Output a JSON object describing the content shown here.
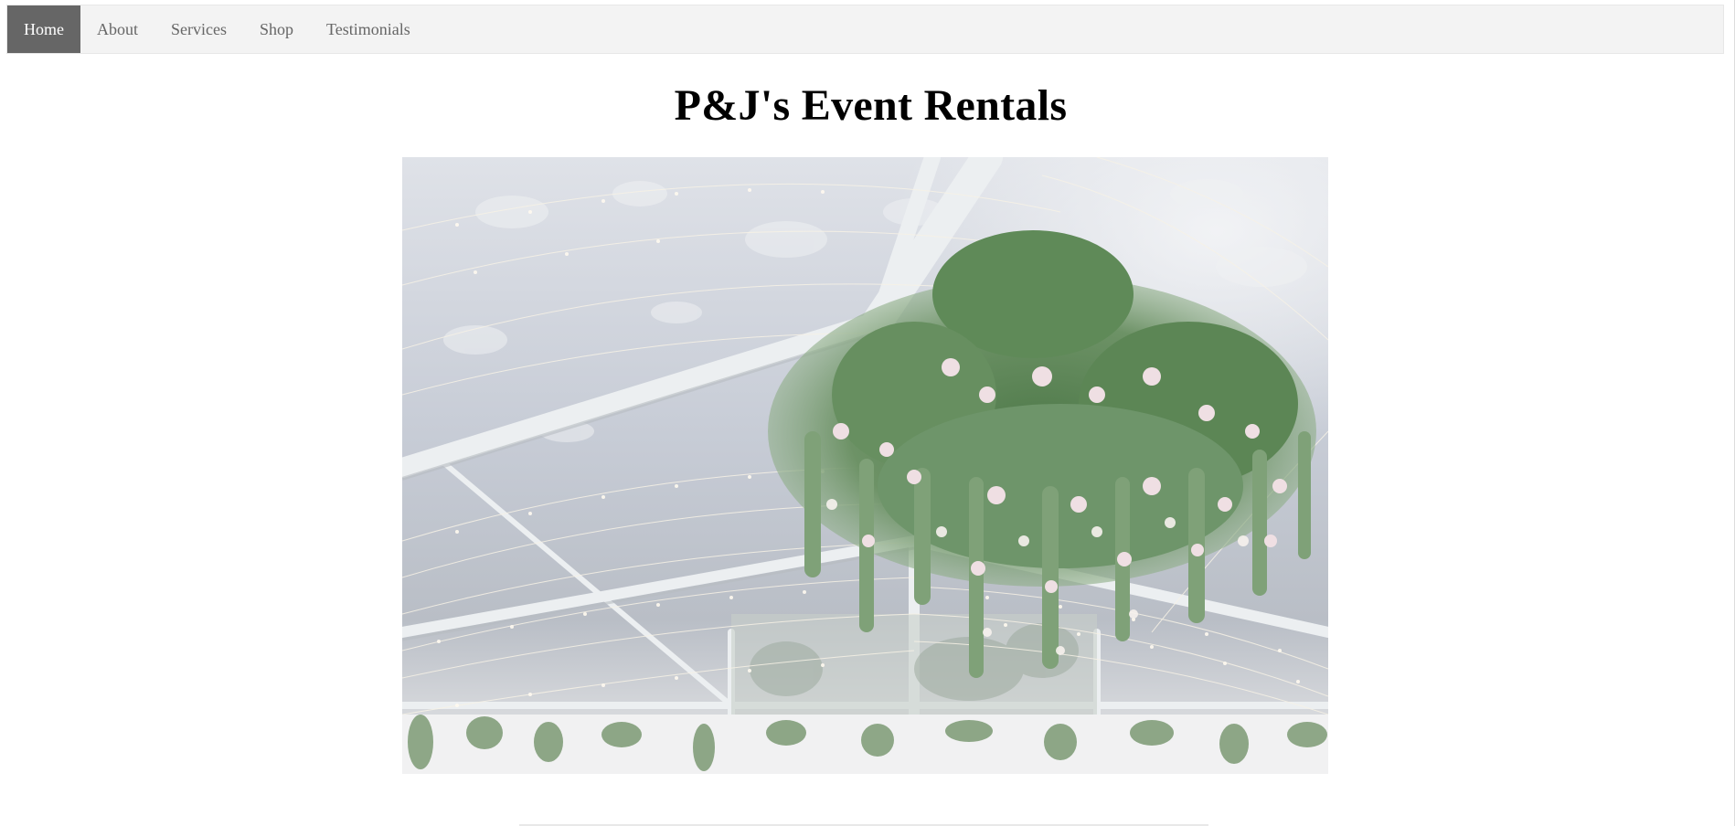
{
  "nav": {
    "items": [
      {
        "label": "Home",
        "active": true
      },
      {
        "label": "About",
        "active": false
      },
      {
        "label": "Services",
        "active": false
      },
      {
        "label": "Shop",
        "active": false
      },
      {
        "label": "Testimonials",
        "active": false
      }
    ]
  },
  "header": {
    "title": "P&J's Event Rentals"
  },
  "hero": {
    "subject": "clear tent ceiling with string lights and hanging floral chandelier"
  },
  "colors": {
    "nav_background": "#f3f3f3",
    "nav_active_background": "#666666",
    "nav_active_text": "#ffffff",
    "nav_text": "#666666",
    "title_text": "#000000"
  }
}
